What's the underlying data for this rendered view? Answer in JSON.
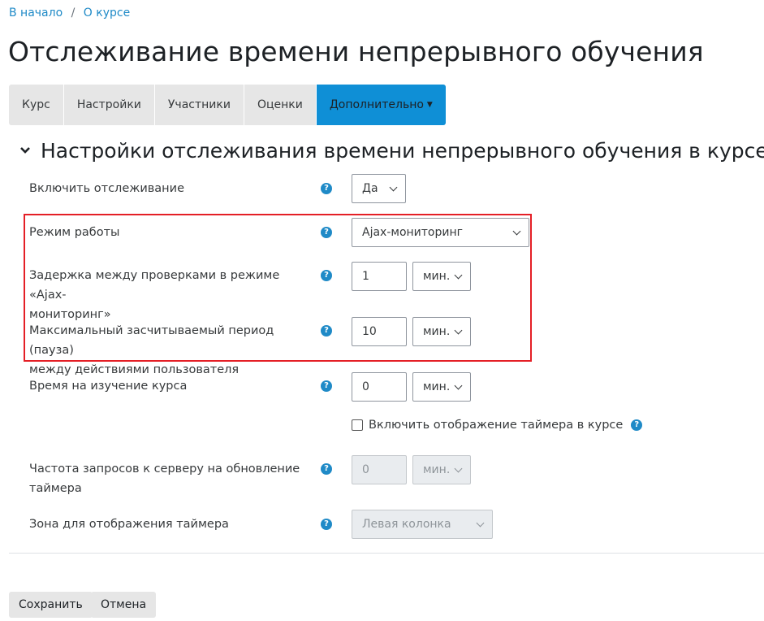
{
  "breadcrumb": {
    "home": "В начало",
    "separator": "/",
    "course": "О курсе"
  },
  "page_title": "Отслеживание времени непрерывного обучения",
  "tabs": [
    {
      "label": "Курс"
    },
    {
      "label": "Настройки"
    },
    {
      "label": "Участники"
    },
    {
      "label": "Оценки"
    },
    {
      "label": "Дополнительно"
    }
  ],
  "section": {
    "title": "Настройки отслеживания времени непрерывного обучения в курсе"
  },
  "fields": {
    "tracking": {
      "label": "Включить отслеживание",
      "value": "Да"
    },
    "mode": {
      "label": "Режим работы",
      "value": "Ajax-мониторинг"
    },
    "delay": {
      "label_line1": "Задержка между проверками в режиме «Ajax-",
      "label_line2": "мониторинг»",
      "value": "1",
      "unit": "мин."
    },
    "max_period": {
      "label_line1": "Максимальный засчитываемый период (пауза)",
      "label_line2": "между действиями пользователя",
      "value": "10",
      "unit": "мин."
    },
    "study_time": {
      "label": "Время на изучение курса",
      "value": "0",
      "unit": "мин."
    },
    "timer_display": {
      "label": "Включить отображение таймера в курсе",
      "checked": false
    },
    "request_freq": {
      "label_line1": "Частота запросов к серверу на обновление",
      "label_line2": "таймера",
      "value": "0",
      "unit": "мин."
    },
    "timer_zone": {
      "label": "Зона для отображения таймера",
      "value": "Левая колонка"
    }
  },
  "help_glyph": "?",
  "buttons": {
    "save": "Сохранить",
    "cancel": "Отмена"
  },
  "colors": {
    "accent": "#0f8fd6",
    "link": "#1f8ac7",
    "highlight_border": "#e41f26"
  }
}
